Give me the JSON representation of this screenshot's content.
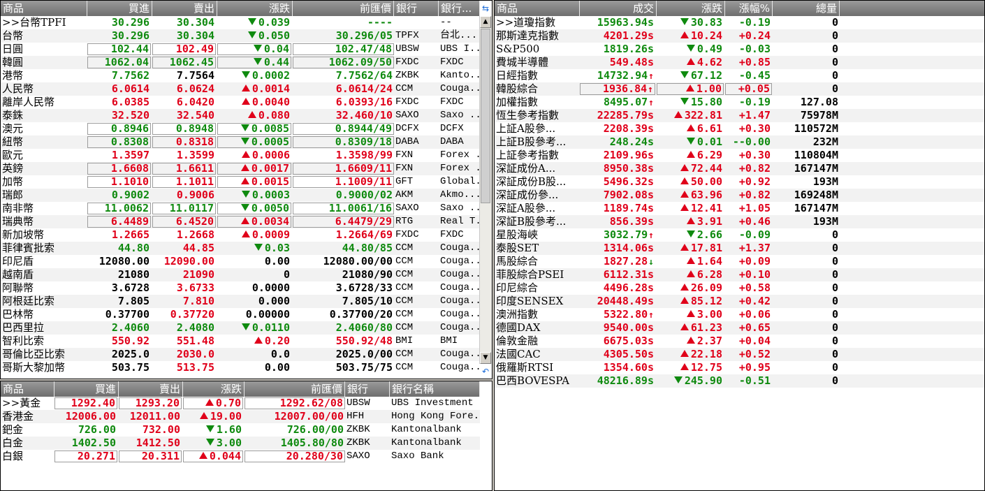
{
  "fx_panel": {
    "headers": [
      "商品",
      "買進",
      "賣出",
      "漲跌",
      "前匯價",
      "銀行",
      "銀行..."
    ],
    "rows": [
      {
        "name": ">>台幣TPFI",
        "bid": "30.296",
        "ask": "30.304",
        "dir": "dn",
        "chg": "0.039",
        "prev": "----",
        "bank": "",
        "bname": "--",
        "color": "dn",
        "askc": "dn"
      },
      {
        "name": "台幣",
        "bid": "30.296",
        "ask": "30.304",
        "dir": "dn",
        "chg": "0.050",
        "prev": "30.296/05",
        "bank": "TPFX",
        "bname": "台北...",
        "color": "dn",
        "askc": "dn"
      },
      {
        "name": "日圓",
        "bid": "102.44",
        "ask": "102.49",
        "dir": "dn",
        "chg": "0.04",
        "prev": "102.47/48",
        "bank": "UBSW",
        "bname": "UBS I...",
        "color": "dn",
        "askc": "up",
        "box": true
      },
      {
        "name": "韓圓",
        "bid": "1062.04",
        "ask": "1062.45",
        "dir": "dn",
        "chg": "0.44",
        "prev": "1062.09/50",
        "bank": "FXDC",
        "bname": "FXDC",
        "color": "dn",
        "askc": "dn",
        "box": true
      },
      {
        "name": "港幣",
        "bid": "7.7562",
        "ask": "7.7564",
        "dir": "dn",
        "chg": "0.0002",
        "prev": "7.7562/64",
        "bank": "ZKBK",
        "bname": "Kanto...",
        "color": "dn",
        "askc": "fl"
      },
      {
        "name": "人民幣",
        "bid": "6.0614",
        "ask": "6.0624",
        "dir": "up",
        "chg": "0.0014",
        "prev": "6.0614/24",
        "bank": "CCM",
        "bname": "Couga...",
        "color": "up",
        "askc": "up"
      },
      {
        "name": "離岸人民幣",
        "bid": "6.0385",
        "ask": "6.0420",
        "dir": "up",
        "chg": "0.0040",
        "prev": "6.0393/16",
        "bank": "FXDC",
        "bname": "FXDC",
        "color": "up",
        "askc": "up"
      },
      {
        "name": "泰銖",
        "bid": "32.520",
        "ask": "32.540",
        "dir": "up",
        "chg": "0.080",
        "prev": "32.460/10",
        "bank": "SAXO",
        "bname": "Saxo ...",
        "color": "up",
        "askc": "up"
      },
      {
        "name": "澳元",
        "bid": "0.8946",
        "ask": "0.8948",
        "dir": "dn",
        "chg": "0.0085",
        "prev": "0.8944/49",
        "bank": "DCFX",
        "bname": "DCFX",
        "color": "dn",
        "askc": "dn",
        "box": true
      },
      {
        "name": "紐幣",
        "bid": "0.8308",
        "ask": "0.8318",
        "dir": "dn",
        "chg": "0.0005",
        "prev": "0.8309/18",
        "bank": "DABA",
        "bname": "DABA",
        "color": "dn",
        "askc": "up",
        "box": true
      },
      {
        "name": "歐元",
        "bid": "1.3597",
        "ask": "1.3599",
        "dir": "up",
        "chg": "0.0006",
        "prev": "1.3598/99",
        "bank": "FXN",
        "bname": "Forex ...",
        "color": "up",
        "askc": "up"
      },
      {
        "name": "英鎊",
        "bid": "1.6608",
        "ask": "1.6611",
        "dir": "up",
        "chg": "0.0017",
        "prev": "1.6609/11",
        "bank": "FXN",
        "bname": "Forex ...",
        "color": "up",
        "askc": "up",
        "box": true
      },
      {
        "name": "加幣",
        "bid": "1.1010",
        "ask": "1.1011",
        "dir": "up",
        "chg": "0.0015",
        "prev": "1.1009/11",
        "bank": "GFT",
        "bname": "Global...",
        "color": "up",
        "askc": "up",
        "box": true
      },
      {
        "name": "瑞郎",
        "bid": "0.9002",
        "ask": "0.9006",
        "dir": "dn",
        "chg": "0.0003",
        "prev": "0.9000/02",
        "bank": "AKM",
        "bname": "Akmo...",
        "color": "dn",
        "askc": "up"
      },
      {
        "name": "南非幣",
        "bid": "11.0062",
        "ask": "11.0117",
        "dir": "dn",
        "chg": "0.0050",
        "prev": "11.0061/16",
        "bank": "SAXO",
        "bname": "Saxo ...",
        "color": "dn",
        "askc": "dn",
        "box": true
      },
      {
        "name": "瑞典幣",
        "bid": "6.4489",
        "ask": "6.4520",
        "dir": "up",
        "chg": "0.0034",
        "prev": "6.4479/29",
        "bank": "RTG",
        "bname": "Real T...",
        "color": "up",
        "askc": "up",
        "box": true
      },
      {
        "name": "新加坡幣",
        "bid": "1.2665",
        "ask": "1.2668",
        "dir": "up",
        "chg": "0.0009",
        "prev": "1.2664/69",
        "bank": "FXDC",
        "bname": "FXDC",
        "color": "up",
        "askc": "up"
      },
      {
        "name": "菲律賓批索",
        "bid": "44.80",
        "ask": "44.85",
        "dir": "dn",
        "chg": "0.03",
        "prev": "44.80/85",
        "bank": "CCM",
        "bname": "Couga...",
        "color": "dn",
        "askc": "up"
      },
      {
        "name": "印尼盾",
        "bid": "12080.00",
        "ask": "12090.00",
        "dir": "",
        "chg": "0.00",
        "prev": "12080.00/00",
        "bank": "CCM",
        "bname": "Couga...",
        "color": "fl",
        "askc": "up"
      },
      {
        "name": "越南盾",
        "bid": "21080",
        "ask": "21090",
        "dir": "",
        "chg": "0",
        "prev": "21080/90",
        "bank": "CCM",
        "bname": "Couga...",
        "color": "fl",
        "askc": "up"
      },
      {
        "name": "阿聯幣",
        "bid": "3.6728",
        "ask": "3.6733",
        "dir": "",
        "chg": "0.0000",
        "prev": "3.6728/33",
        "bank": "CCM",
        "bname": "Couga...",
        "color": "fl",
        "askc": "up"
      },
      {
        "name": "阿根廷比索",
        "bid": "7.805",
        "ask": "7.810",
        "dir": "",
        "chg": "0.000",
        "prev": "7.805/10",
        "bank": "CCM",
        "bname": "Couga...",
        "color": "fl",
        "askc": "up"
      },
      {
        "name": "巴林幣",
        "bid": "0.37700",
        "ask": "0.37720",
        "dir": "",
        "chg": "0.00000",
        "prev": "0.37700/20",
        "bank": "CCM",
        "bname": "Couga...",
        "color": "fl",
        "askc": "up"
      },
      {
        "name": "巴西里拉",
        "bid": "2.4060",
        "ask": "2.4080",
        "dir": "dn",
        "chg": "0.0110",
        "prev": "2.4060/80",
        "bank": "CCM",
        "bname": "Couga...",
        "color": "dn",
        "askc": "dn"
      },
      {
        "name": "智利比索",
        "bid": "550.92",
        "ask": "551.48",
        "dir": "up",
        "chg": "0.20",
        "prev": "550.92/48",
        "bank": "BMI",
        "bname": "BMI",
        "color": "up",
        "askc": "up"
      },
      {
        "name": "哥倫比亞比索",
        "bid": "2025.0",
        "ask": "2030.0",
        "dir": "",
        "chg": "0.0",
        "prev": "2025.0/00",
        "bank": "CCM",
        "bname": "Couga...",
        "color": "fl",
        "askc": "up"
      },
      {
        "name": "哥斯大黎加幣",
        "bid": "503.75",
        "ask": "513.75",
        "dir": "",
        "chg": "0.00",
        "prev": "503.75/75",
        "bank": "CCM",
        "bname": "Couga...",
        "color": "fl",
        "askc": "up"
      }
    ]
  },
  "metal_panel": {
    "headers": [
      "商品",
      "買進",
      "賣出",
      "漲跌",
      "前匯價",
      "銀行",
      "銀行名稱"
    ],
    "rows": [
      {
        "name": ">>黃金",
        "bid": "1292.40",
        "ask": "1293.20",
        "dir": "up",
        "chg": "0.70",
        "prev": "1292.62/08",
        "bank": "UBSW",
        "bname": "UBS Investment ...",
        "color": "up",
        "askc": "up",
        "box": true
      },
      {
        "name": "香港金",
        "bid": "12006.00",
        "ask": "12011.00",
        "dir": "up",
        "chg": "19.00",
        "prev": "12007.00/00",
        "bank": "HFH",
        "bname": "Hong Kong Fore...",
        "color": "up",
        "askc": "up"
      },
      {
        "name": "鈀金",
        "bid": "726.00",
        "ask": "732.00",
        "dir": "dn",
        "chg": "1.60",
        "prev": "726.00/00",
        "bank": "ZKBK",
        "bname": "Kantonalbank",
        "color": "dn",
        "askc": "up"
      },
      {
        "name": "白金",
        "bid": "1402.50",
        "ask": "1412.50",
        "dir": "dn",
        "chg": "3.00",
        "prev": "1405.80/80",
        "bank": "ZKBK",
        "bname": "Kantonalbank",
        "color": "dn",
        "askc": "up"
      },
      {
        "name": "白銀",
        "bid": "20.271",
        "ask": "20.311",
        "dir": "up",
        "chg": "0.044",
        "prev": "20.280/30",
        "bank": "SAXO",
        "bname": "Saxo Bank",
        "color": "up",
        "askc": "up",
        "box": true
      }
    ]
  },
  "index_panel": {
    "headers": [
      "商品",
      "成交",
      "漲跌",
      "漲幅%",
      "總量"
    ],
    "rows": [
      {
        "name": ">>道瓊指數",
        "price": "15963.94s",
        "pdir": "",
        "dir": "dn",
        "chg": "30.83",
        "pct": "-0.19",
        "vol": "0",
        "color": "dn"
      },
      {
        "name": "那斯達克指數",
        "price": "4201.29s",
        "pdir": "",
        "dir": "up",
        "chg": "10.24",
        "pct": "+0.24",
        "vol": "0",
        "color": "up"
      },
      {
        "name": "S&P500",
        "price": "1819.26s",
        "pdir": "",
        "dir": "dn",
        "chg": "0.49",
        "pct": "-0.03",
        "vol": "0",
        "color": "dn"
      },
      {
        "name": "費城半導體",
        "price": "549.48s",
        "pdir": "",
        "dir": "up",
        "chg": "4.62",
        "pct": "+0.85",
        "vol": "0",
        "color": "up"
      },
      {
        "name": "日經指數",
        "price": "14732.94",
        "pdir": "up",
        "dir": "dn",
        "chg": "67.12",
        "pct": "-0.45",
        "vol": "0",
        "color": "dn"
      },
      {
        "name": "韓股綜合",
        "price": "1936.84",
        "pdir": "up",
        "dir": "up",
        "chg": "1.00",
        "pct": "+0.05",
        "vol": "0",
        "color": "up",
        "box": true
      },
      {
        "name": "加權指數",
        "price": "8495.07",
        "pdir": "up",
        "dir": "dn",
        "chg": "15.80",
        "pct": "-0.19",
        "vol": "127.08",
        "color": "dn"
      },
      {
        "name": "恆生參考指數",
        "price": "22285.79s",
        "pdir": "",
        "dir": "up",
        "chg": "322.81",
        "pct": "+1.47",
        "vol": "75978M",
        "color": "up"
      },
      {
        "name": "上証A股參...",
        "price": "2208.39s",
        "pdir": "",
        "dir": "up",
        "chg": "6.61",
        "pct": "+0.30",
        "vol": "110572M",
        "color": "up"
      },
      {
        "name": "上証B股參考...",
        "price": "248.24s",
        "pdir": "",
        "dir": "dn",
        "chg": "0.01",
        "pct": "--0.00",
        "vol": "232M",
        "color": "dn"
      },
      {
        "name": "上証參考指數",
        "price": "2109.96s",
        "pdir": "",
        "dir": "up",
        "chg": "6.29",
        "pct": "+0.30",
        "vol": "110804M",
        "color": "up"
      },
      {
        "name": "深証成份A...",
        "price": "8950.38s",
        "pdir": "",
        "dir": "up",
        "chg": "72.44",
        "pct": "+0.82",
        "vol": "167147M",
        "color": "up"
      },
      {
        "name": "深証成份B股...",
        "price": "5496.32s",
        "pdir": "",
        "dir": "up",
        "chg": "50.00",
        "pct": "+0.92",
        "vol": "193M",
        "color": "up"
      },
      {
        "name": "深証成份參...",
        "price": "7902.08s",
        "pdir": "",
        "dir": "up",
        "chg": "63.96",
        "pct": "+0.82",
        "vol": "169248M",
        "color": "up"
      },
      {
        "name": "深証A股參...",
        "price": "1189.74s",
        "pdir": "",
        "dir": "up",
        "chg": "12.41",
        "pct": "+1.05",
        "vol": "167147M",
        "color": "up"
      },
      {
        "name": "深証B股參考...",
        "price": "856.39s",
        "pdir": "",
        "dir": "up",
        "chg": "3.91",
        "pct": "+0.46",
        "vol": "193M",
        "color": "up"
      },
      {
        "name": "星股海峽",
        "price": "3032.79",
        "pdir": "up",
        "dir": "dn",
        "chg": "2.66",
        "pct": "-0.09",
        "vol": "0",
        "color": "dn"
      },
      {
        "name": "泰股SET",
        "price": "1314.06s",
        "pdir": "",
        "dir": "up",
        "chg": "17.81",
        "pct": "+1.37",
        "vol": "0",
        "color": "up"
      },
      {
        "name": "馬股綜合",
        "price": "1827.28",
        "pdir": "dn",
        "dir": "up",
        "chg": "1.64",
        "pct": "+0.09",
        "vol": "0",
        "color": "up"
      },
      {
        "name": "菲股綜合PSEI",
        "price": "6112.31s",
        "pdir": "",
        "dir": "up",
        "chg": "6.28",
        "pct": "+0.10",
        "vol": "0",
        "color": "up"
      },
      {
        "name": "印尼綜合",
        "price": "4496.28s",
        "pdir": "",
        "dir": "up",
        "chg": "26.09",
        "pct": "+0.58",
        "vol": "0",
        "color": "up"
      },
      {
        "name": "印度SENSEX",
        "price": "20448.49s",
        "pdir": "",
        "dir": "up",
        "chg": "85.12",
        "pct": "+0.42",
        "vol": "0",
        "color": "up"
      },
      {
        "name": "澳洲指數",
        "price": "5322.80",
        "pdir": "up",
        "dir": "up",
        "chg": "3.00",
        "pct": "+0.06",
        "vol": "0",
        "color": "up"
      },
      {
        "name": "德國DAX",
        "price": "9540.00s",
        "pdir": "",
        "dir": "up",
        "chg": "61.23",
        "pct": "+0.65",
        "vol": "0",
        "color": "up"
      },
      {
        "name": "倫敦金融",
        "price": "6675.03s",
        "pdir": "",
        "dir": "up",
        "chg": "2.37",
        "pct": "+0.04",
        "vol": "0",
        "color": "up"
      },
      {
        "name": "法國CAC",
        "price": "4305.50s",
        "pdir": "",
        "dir": "up",
        "chg": "22.18",
        "pct": "+0.52",
        "vol": "0",
        "color": "up"
      },
      {
        "name": "俄羅斯RTSI",
        "price": "1354.60s",
        "pdir": "",
        "dir": "up",
        "chg": "12.75",
        "pct": "+0.95",
        "vol": "0",
        "color": "up"
      },
      {
        "name": "巴西BOVESPA",
        "price": "48216.89s",
        "pdir": "",
        "dir": "dn",
        "chg": "245.90",
        "pct": "-0.51",
        "vol": "0",
        "color": "dn"
      }
    ]
  },
  "colors": {
    "up": "#e0001a",
    "down": "#0f8a0f",
    "header": "#7a7a7a"
  },
  "icons": {
    "settings": "refresh-config-icon"
  }
}
